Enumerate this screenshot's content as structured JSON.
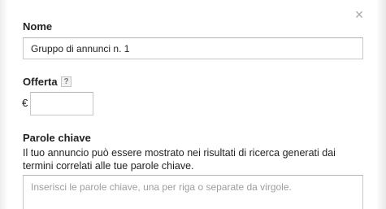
{
  "dialog": {
    "close_glyph": "×"
  },
  "name_section": {
    "label": "Nome",
    "value": "Gruppo di annunci n. 1"
  },
  "offer_section": {
    "label": "Offerta",
    "help_glyph": "?",
    "currency_symbol": "€",
    "value": ""
  },
  "keywords_section": {
    "label": "Parole chiave",
    "description": "Il tuo annuncio può essere mostrato nei risultati di ricerca generati dai termini correlati alle tue parole chiave.",
    "placeholder": "Inserisci le parole chiave, una per riga o separate da virgole."
  }
}
